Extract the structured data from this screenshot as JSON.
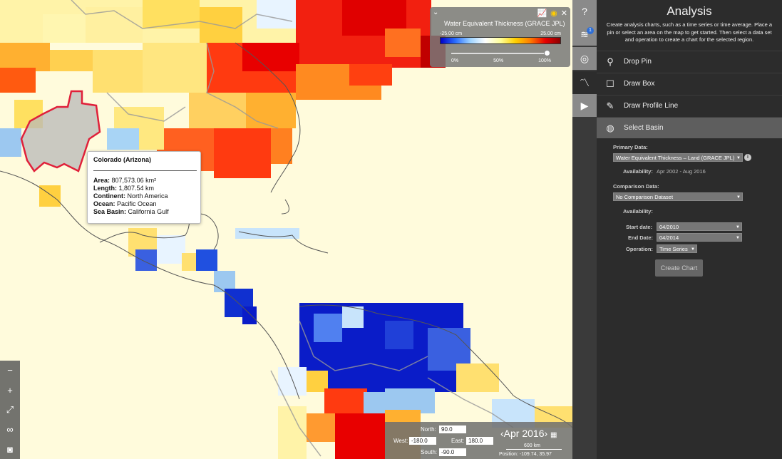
{
  "legend": {
    "title": "Water Equivalent Thickness (GRACE JPL)",
    "min_label": "-25.00 cm",
    "max_label": "25.00 cm",
    "opacity_ticks": [
      "0%",
      "50%",
      "100%"
    ],
    "opacity_value": 1.0
  },
  "tooltip": {
    "name": "Colorado (Arizona)",
    "area_label": "Area:",
    "area_value": "807,573.06 km²",
    "length_label": "Length:",
    "length_value": "1,807.54 km",
    "continent_label": "Continent:",
    "continent_value": "North America",
    "ocean_label": "Ocean:",
    "ocean_value": "Pacific Ocean",
    "seabasin_label": "Sea Basin:",
    "seabasin_value": "California Gulf"
  },
  "bounds": {
    "north_label": "North:",
    "north_value": "90.0",
    "west_label": "West:",
    "west_value": "-180.0",
    "east_label": "East:",
    "east_value": "180.0",
    "south_label": "South:",
    "south_value": "-90.0",
    "date": "‹Apr 2016›",
    "scale": "600 km",
    "position": "Position: -109.74, 35.97"
  },
  "panel": {
    "title": "Analysis",
    "description": "Create analysis charts, such as a time series or time average. Place a pin or select an area on the map to get started. Then select a data set and operation to create a chart for the selected region.",
    "tools": [
      {
        "label": "Drop Pin",
        "icon": "pin-icon"
      },
      {
        "label": "Draw Box",
        "icon": "box-icon"
      },
      {
        "label": "Draw Profile Line",
        "icon": "pencil-icon"
      },
      {
        "label": "Select Basin",
        "icon": "globe-icon"
      }
    ],
    "primary_label": "Primary Data:",
    "primary_value": "Water Equivalent Thickness – Land (GRACE JPL)",
    "availability_label": "Availability:",
    "availability_value": "Apr 2002 - Aug 2016",
    "comparison_label": "Comparison Data:",
    "comparison_value": "No Comparison Dataset",
    "availability2_label": "Availability:",
    "start_label": "Start date:",
    "start_value": "04/2010",
    "end_label": "End Date:",
    "end_value": "04/2014",
    "operation_label": "Operation:",
    "operation_value": "Time Series",
    "create_label": "Create Chart"
  },
  "iconstrip": {
    "badge": "1"
  },
  "colors": {
    "panel_bg": "#2c2c2c",
    "selected_tool": "#5e5e5e",
    "basin_outline": "#e0203a"
  }
}
